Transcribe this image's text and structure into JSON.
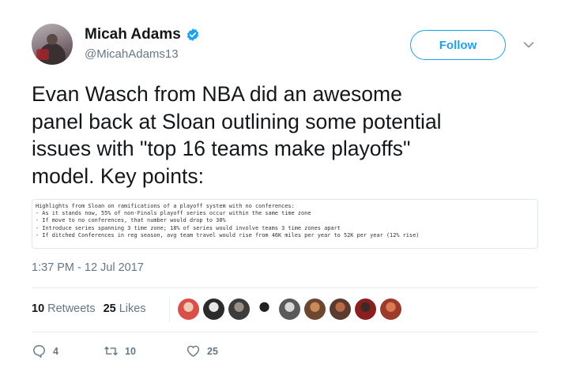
{
  "author": {
    "name": "Micah Adams",
    "handle": "@MicahAdams13",
    "verified": true
  },
  "follow_button": {
    "label": "Follow"
  },
  "tweet": {
    "text": "Evan Wasch from NBA did an awesome\npanel back at Sloan outlining some potential\nissues with \"top 16 teams make playoffs\"\nmodel. Key points:",
    "image_text_lines": [
      "Highlights from Sloan on ramifications of a playoff system with no conferences:",
      "- As it stands now, 55% of non-Finals playoff series occur within the same time zone",
      "- If move to no conferences, that number would drop to 30%",
      "- Introduce series spanning 3 time zone; 18% of series would involve teams 3 time zones apart",
      "- If ditched Conferences in reg season, avg team travel would rise from 46K miles per year to 52K per year (12% rise)"
    ],
    "timestamp": "1:37 PM - 12 Jul 2017"
  },
  "stats": {
    "retweets_count": "10",
    "retweets_label": "Retweets",
    "likes_count": "25",
    "likes_label": "Likes"
  },
  "liker_avatars": [
    {
      "icon": "liker-avatar-1",
      "colors": [
        "#d94f4a",
        "#f2c9b3"
      ]
    },
    {
      "icon": "liker-avatar-2",
      "colors": [
        "#2b2b2b",
        "#e8e8e8"
      ]
    },
    {
      "icon": "liker-avatar-3",
      "colors": [
        "#3c3c3c",
        "#9a8f85"
      ]
    },
    {
      "icon": "liker-avatar-4",
      "colors": [
        "#ffffff",
        "#222222"
      ]
    },
    {
      "icon": "liker-avatar-5",
      "colors": [
        "#5a5a5a",
        "#d8d8d8"
      ]
    },
    {
      "icon": "liker-avatar-6",
      "colors": [
        "#6d4630",
        "#c98c58"
      ]
    },
    {
      "icon": "liker-avatar-7",
      "colors": [
        "#5b3a2f",
        "#b86b47"
      ]
    },
    {
      "icon": "liker-avatar-8",
      "colors": [
        "#8a1f1f",
        "#3d2a25"
      ]
    },
    {
      "icon": "liker-avatar-9",
      "colors": [
        "#9c3b2b",
        "#d97a54"
      ]
    }
  ],
  "actions": {
    "reply_count": "4",
    "retweet_count": "10",
    "like_count": "25"
  },
  "colors": {
    "accent": "#1da1f2",
    "text_primary": "#14171a",
    "text_secondary": "#657786"
  },
  "icons": [
    "verified-badge-icon",
    "chevron-down-icon",
    "reply-icon",
    "retweet-icon",
    "heart-icon"
  ]
}
